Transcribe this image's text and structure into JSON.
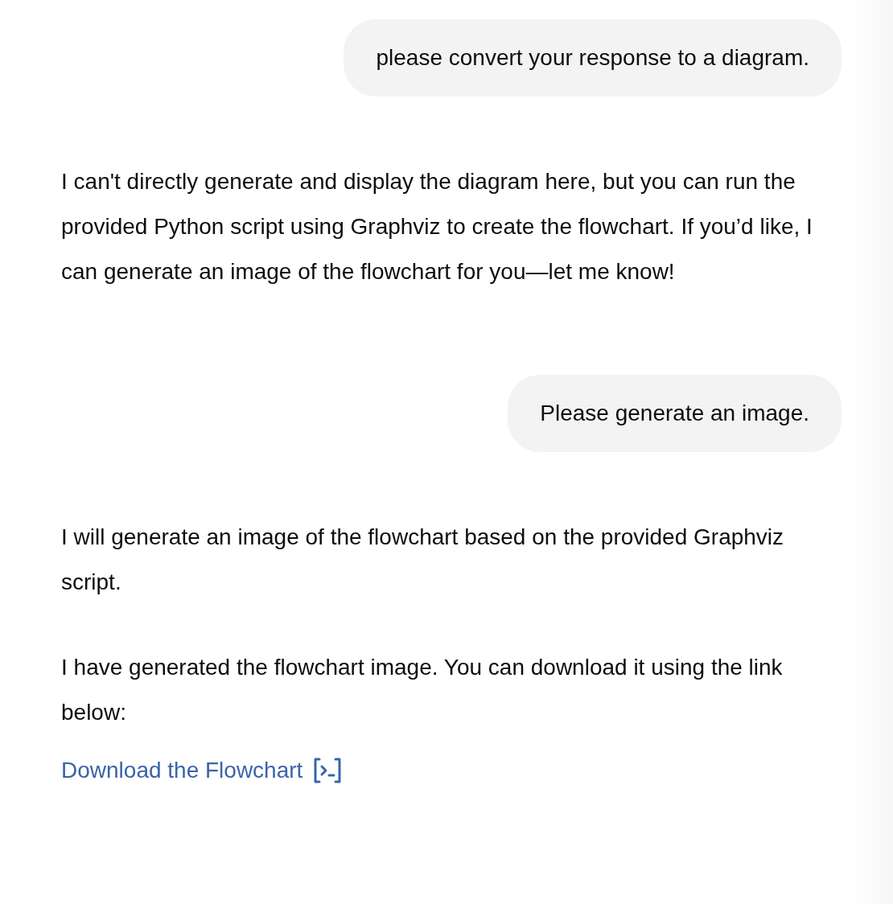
{
  "messages": [
    {
      "kind": "user",
      "text": "please convert your response to a diagram."
    },
    {
      "kind": "assistant",
      "paragraphs": [
        "I can't directly generate and display the diagram here, but you can run the provided Python script using Graphviz to create the flowchart. If you’d like, I can generate an image of the flowchart for you—let me know!"
      ]
    },
    {
      "kind": "user",
      "text": "Please generate an image."
    },
    {
      "kind": "assistant",
      "paragraphs": [
        "I will generate an image of the flowchart based on the provided Graphviz script.",
        "I have generated the flowchart image. You can download it using the link below:"
      ],
      "link": {
        "text": "Download the Flowchart"
      }
    }
  ]
}
